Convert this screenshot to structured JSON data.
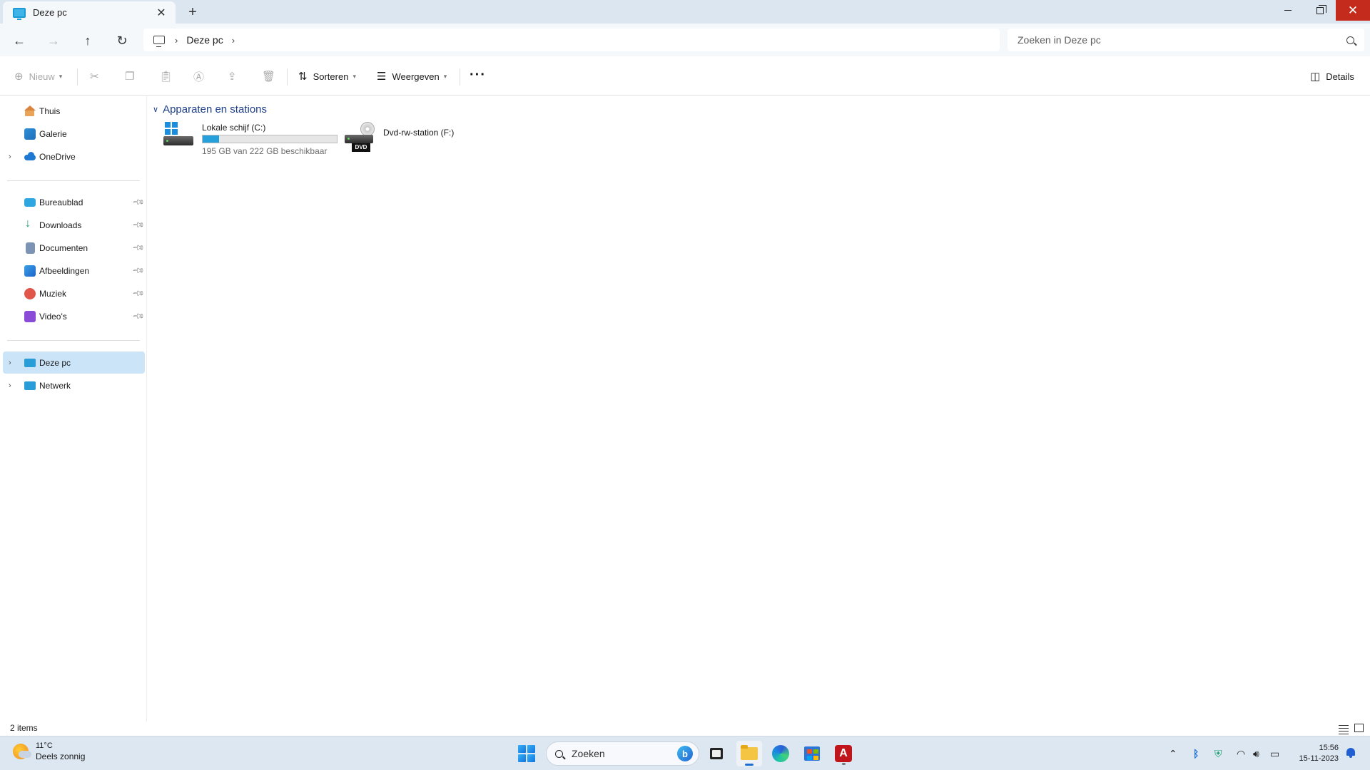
{
  "window": {
    "tab_title": "Deze pc",
    "tab_close": "✕",
    "new_tab": "+",
    "minimize": "",
    "close": "✕"
  },
  "address": {
    "breadcrumb": [
      "Deze pc"
    ],
    "search_placeholder": "Zoeken in Deze pc"
  },
  "commands": {
    "new": "Nieuw",
    "sort": "Sorteren",
    "view": "Weergeven",
    "more": "···",
    "details": "Details"
  },
  "nav": {
    "top": [
      {
        "label": "Thuis",
        "icon": "home-icon"
      },
      {
        "label": "Galerie",
        "icon": "gallery-icon"
      },
      {
        "label": "OneDrive",
        "icon": "onedrive-icon"
      }
    ],
    "pinned": [
      {
        "label": "Bureaublad",
        "icon": "desktop-icon"
      },
      {
        "label": "Downloads",
        "icon": "downloads-icon"
      },
      {
        "label": "Documenten",
        "icon": "documents-icon"
      },
      {
        "label": "Afbeeldingen",
        "icon": "pictures-icon"
      },
      {
        "label": "Muziek",
        "icon": "music-icon"
      },
      {
        "label": "Video's",
        "icon": "videos-icon"
      }
    ],
    "bottom": [
      {
        "label": "Deze pc",
        "icon": "this-pc-icon",
        "selected": true
      },
      {
        "label": "Netwerk",
        "icon": "network-icon"
      }
    ]
  },
  "content": {
    "group_title": "Apparaten en stations",
    "drives": [
      {
        "name": "Lokale schijf (C:)",
        "free_text": "195 GB van 222 GB beschikbaar",
        "used_fraction": 0.12
      },
      {
        "name": "Dvd-rw-station (F:)",
        "badge": "DVD"
      }
    ]
  },
  "status": {
    "item_count": "2 items"
  },
  "taskbar": {
    "weather_temp": "11°C",
    "weather_desc": "Deels zonnig",
    "search_placeholder": "Zoeken",
    "bing_label": "b",
    "acrobat_glyph": "A",
    "time": "15:56",
    "date": "15-11-2023"
  },
  "colors": {
    "accent": "#26a0da",
    "close_button": "#c42b1c",
    "nav_selected": "#cce4f7",
    "group_title": "#1e3f8a"
  }
}
